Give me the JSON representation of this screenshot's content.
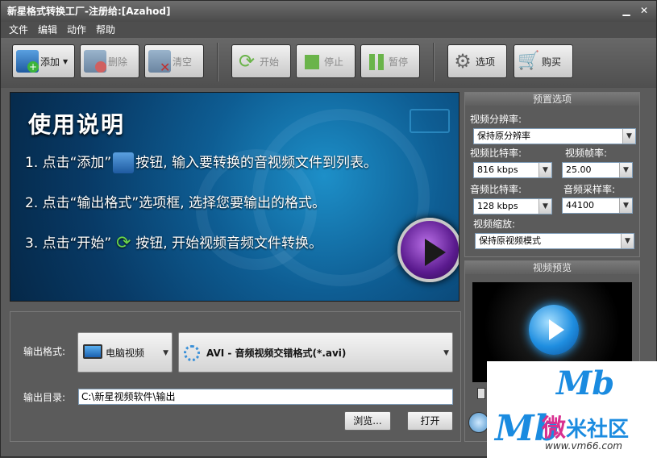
{
  "window": {
    "title": "新星格式转换工厂-注册给:[Azahod]",
    "controls": [
      "▁",
      "✕"
    ]
  },
  "menu": [
    "文件",
    "编辑",
    "动作",
    "帮助"
  ],
  "toolbar": {
    "add": "添加",
    "delete": "删除",
    "clear": "清空",
    "start": "开始",
    "stop": "停止",
    "pause": "暂停",
    "options": "选项",
    "buy": "购买"
  },
  "banner": {
    "heading": "使用说明",
    "line1a": "1. 点击“添加”",
    "line1b": "按钮, 输入要转换的音视频文件到列表。",
    "line2": "2. 点击“输出格式”选项框, 选择您要输出的格式。",
    "line3a": "3. 点击“开始”",
    "line3b": "按钮, 开始视频音频文件转换。"
  },
  "preset": {
    "title": "预置选项",
    "resolution_label": "视频分辨率:",
    "resolution_value": "保持原分辨率",
    "vbitrate_label": "视频比特率:",
    "vbitrate_value": "816 kbps",
    "fps_label": "视频帧率:",
    "fps_value": "25.00",
    "abitrate_label": "音频比特率:",
    "abitrate_value": "128 kbps",
    "samplerate_label": "音频采样率:",
    "samplerate_value": "44100",
    "scale_label": "视频缩放:",
    "scale_value": "保持原视频模式"
  },
  "preview": {
    "title": "视频预览"
  },
  "output": {
    "format_label": "输出格式:",
    "device_value": "电脑视频",
    "format_value": "AVI - 音频视频交错格式(*.avi)",
    "dir_label": "输出目录:",
    "dir_value": "C:\\新星视频软件\\输出",
    "browse": "浏览...",
    "open": "打开"
  },
  "watermark": {
    "text1": "微",
    "text2": "米社区",
    "url": "www.vm66.com"
  },
  "colors": {
    "accent": "#1a8be0",
    "banner": "#0e5d93",
    "watermark_pink": "#d83090"
  }
}
